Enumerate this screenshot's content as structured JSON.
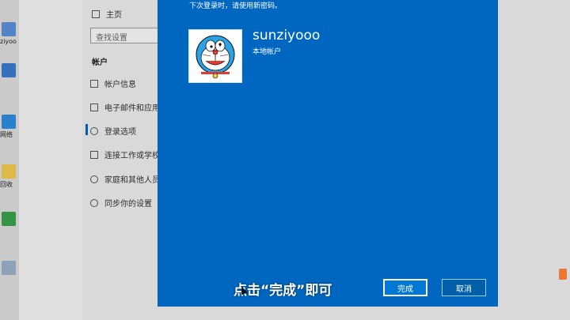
{
  "desktop": {
    "icons": [
      {
        "label": "ziyoo",
        "color": "#5a8fd8"
      },
      {
        "label": "",
        "color": "#3a7ad0"
      },
      {
        "label": "网络",
        "color": "#2f8be0"
      },
      {
        "label": "回收",
        "color": "#f2c94c"
      },
      {
        "label": "",
        "color": "#3aa14a"
      },
      {
        "label": "",
        "color": "#9ab0c8"
      }
    ]
  },
  "settings": {
    "home": "主页",
    "search_placeholder": "查找设置",
    "section": "帐户",
    "items": [
      {
        "label": "帐户信息",
        "icon": "person-card-icon"
      },
      {
        "label": "电子邮件和应用",
        "icon": "mail-icon"
      },
      {
        "label": "登录选项",
        "icon": "key-icon"
      },
      {
        "label": "连接工作或学校",
        "icon": "briefcase-icon"
      },
      {
        "label": "家庭和其他人员",
        "icon": "person-add-icon"
      },
      {
        "label": "同步你的设置",
        "icon": "sync-icon"
      }
    ]
  },
  "dialog": {
    "instruction": "下次登录时，请使用新密码。",
    "username": "sunziyooo",
    "account_type": "本地帐户",
    "finish_button": "完成",
    "cancel_button": "取消",
    "accent": "#0067c0"
  },
  "subtitle": "点击“完成”即可"
}
